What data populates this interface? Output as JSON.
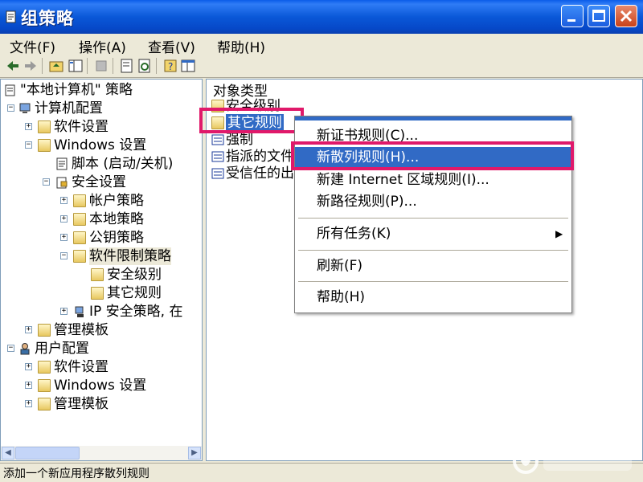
{
  "window": {
    "title": "组策略"
  },
  "menu": [
    {
      "label": "文件(F)"
    },
    {
      "label": "操作(A)"
    },
    {
      "label": "查看(V)"
    },
    {
      "label": "帮助(H)"
    }
  ],
  "tree": [
    {
      "label": "\"本地计算机\" 策略",
      "expander": "",
      "icon": "policy-icon"
    },
    {
      "label": "计算机配置",
      "expander": "−",
      "icon": "computer-icon"
    },
    {
      "label": "软件设置",
      "expander": "+",
      "icon": "folder-icon"
    },
    {
      "label": "Windows 设置",
      "expander": "−",
      "icon": "folder-icon"
    },
    {
      "label": "脚本 (启动/关机)",
      "expander": "",
      "icon": "script-icon"
    },
    {
      "label": "安全设置",
      "expander": "−",
      "icon": "security-icon"
    },
    {
      "label": "帐户策略",
      "expander": "+",
      "icon": "folder-icon"
    },
    {
      "label": "本地策略",
      "expander": "+",
      "icon": "folder-icon"
    },
    {
      "label": "公钥策略",
      "expander": "+",
      "icon": "folder-icon"
    },
    {
      "label": "软件限制策略",
      "expander": "−",
      "icon": "folder-open-icon"
    },
    {
      "label": "安全级别",
      "expander": "",
      "icon": "folder-icon"
    },
    {
      "label": "其它规则",
      "expander": "",
      "icon": "folder-icon"
    },
    {
      "label": "IP 安全策略, 在",
      "expander": "+",
      "icon": "ipsec-icon"
    },
    {
      "label": "管理模板",
      "expander": "+",
      "icon": "folder-icon"
    },
    {
      "label": "用户配置",
      "expander": "−",
      "icon": "user-icon"
    },
    {
      "label": "软件设置",
      "expander": "+",
      "icon": "folder-icon"
    },
    {
      "label": "Windows 设置",
      "expander": "+",
      "icon": "folder-icon"
    },
    {
      "label": "管理模板",
      "expander": "+",
      "icon": "folder-icon"
    }
  ],
  "list": {
    "header": "对象类型",
    "items": [
      {
        "label": "安全级别",
        "icon": "folder-icon"
      },
      {
        "label": "其它规则",
        "icon": "folder-icon"
      },
      {
        "label": "强制",
        "icon": "policy-icon"
      },
      {
        "label": "指派的文件",
        "icon": "policy-icon"
      },
      {
        "label": "受信任的出",
        "icon": "policy-icon"
      }
    ]
  },
  "context_menu": {
    "items": [
      {
        "label": "新证书规则(C)..."
      },
      {
        "label": "新散列规则(H)..."
      },
      {
        "label": "新建 Internet 区域规则(I)..."
      },
      {
        "label": "新路径规则(P)..."
      },
      {
        "label": "所有任务(K)"
      },
      {
        "label": "刷新(F)"
      },
      {
        "label": "帮助(H)"
      }
    ]
  },
  "status": {
    "text": "添加一个新应用程序散列规则"
  },
  "colors": {
    "title_bar": "#0a58d8",
    "selection": "#316ac5",
    "highlight_box": "#e0196a"
  }
}
